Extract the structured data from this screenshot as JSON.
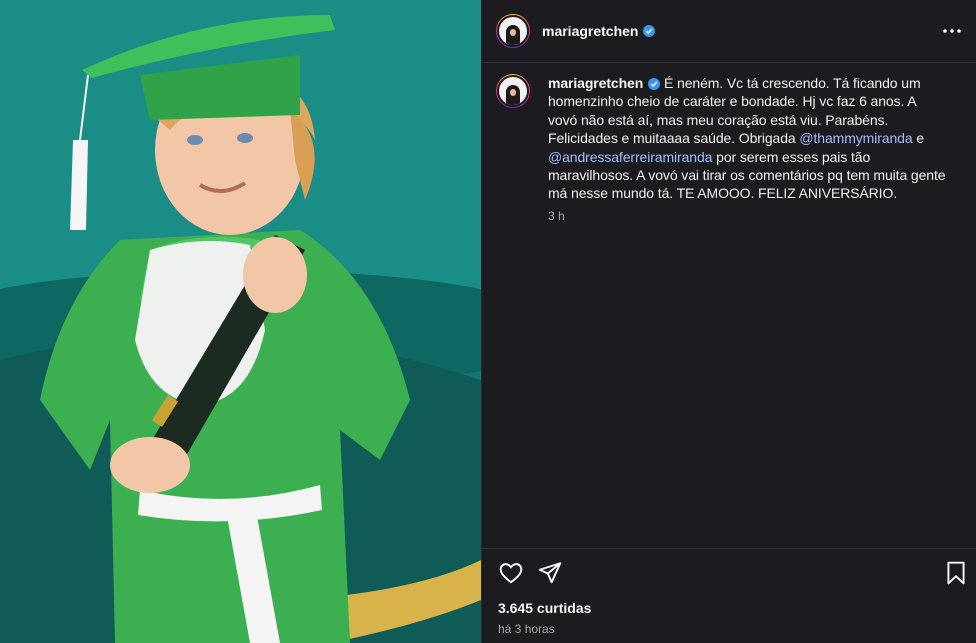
{
  "post": {
    "username": "maria gretchen",
    "username_display": "mariagretchen",
    "more_icon": "more-horizontal-icon",
    "caption": {
      "part1": " É neném. Vc tá crescendo. Tá ficando um homenzinho cheio de caráter e bondade. Hj vc faz 6 anos. A vovó não está aí, mas meu coração está viu. Parabéns. Felicidades e muitaaaa saúde. Obrigada ",
      "mention1": "@thammymiranda",
      "part2": " e ",
      "mention2": "@andressaferreiramiranda",
      "part3": " por serem esses pais tão maravilhosos. A vovó vai tirar os comentários pq tem muita gente má nesse mundo tá. TE AMOOO. FELIZ ANIVERSÁRIO."
    },
    "caption_time": "3 h",
    "likes": "3.645 curtidas",
    "date": "há 3 horas"
  },
  "icons": {
    "like": "heart-icon",
    "share": "send-icon",
    "save": "bookmark-icon",
    "verified": "verified-badge-icon"
  },
  "colors": {
    "background": "#1c1c20",
    "mention": "#a6b8ff",
    "verified": "#3897f0",
    "muted": "#a8a8a8"
  }
}
